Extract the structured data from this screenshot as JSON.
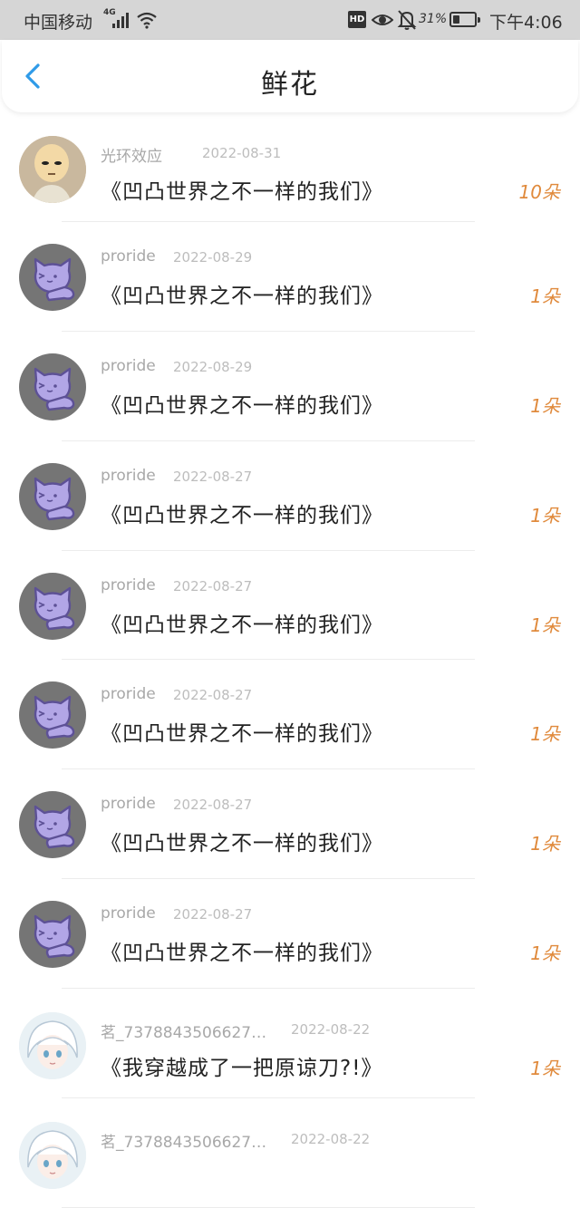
{
  "status_bar": {
    "carrier": "中国移动",
    "network": "4G",
    "battery_percent": "31%",
    "battery_level": 0.31,
    "time": "下午4:06",
    "hd_badge": "HD",
    "icons": [
      "signal-icon",
      "wifi-icon",
      "hd-icon",
      "eye-icon",
      "bell-off-icon",
      "battery-icon"
    ]
  },
  "header": {
    "title": "鲜花",
    "back_icon": "chevron-left-icon"
  },
  "colors": {
    "accent_blue": "#2f9be8",
    "flower_orange": "#e08a3c",
    "status_bar_bg": "#d6d6d6"
  },
  "items": [
    {
      "avatar": "photo",
      "user": "光环效应",
      "date": "2022-08-31",
      "book": "《凹凸世界之不一样的我们》",
      "count": "10朵"
    },
    {
      "avatar": "cat",
      "user": "proride",
      "date": "2022-08-29",
      "book": "《凹凸世界之不一样的我们》",
      "count": "1朵"
    },
    {
      "avatar": "cat",
      "user": "proride",
      "date": "2022-08-29",
      "book": "《凹凸世界之不一样的我们》",
      "count": "1朵"
    },
    {
      "avatar": "cat",
      "user": "proride",
      "date": "2022-08-27",
      "book": "《凹凸世界之不一样的我们》",
      "count": "1朵"
    },
    {
      "avatar": "cat",
      "user": "proride",
      "date": "2022-08-27",
      "book": "《凹凸世界之不一样的我们》",
      "count": "1朵"
    },
    {
      "avatar": "cat",
      "user": "proride",
      "date": "2022-08-27",
      "book": "《凹凸世界之不一样的我们》",
      "count": "1朵"
    },
    {
      "avatar": "cat",
      "user": "proride",
      "date": "2022-08-27",
      "book": "《凹凸世界之不一样的我们》",
      "count": "1朵"
    },
    {
      "avatar": "cat",
      "user": "proride",
      "date": "2022-08-27",
      "book": "《凹凸世界之不一样的我们》",
      "count": "1朵"
    },
    {
      "avatar": "anime",
      "user": "茗_7378843506627…",
      "date": "2022-08-22",
      "book": "《我穿越成了一把原谅刀?!》",
      "count": "1朵"
    },
    {
      "avatar": "anime",
      "user": "茗_7378843506627…",
      "date": "2022-08-22",
      "book": "",
      "count": ""
    }
  ]
}
